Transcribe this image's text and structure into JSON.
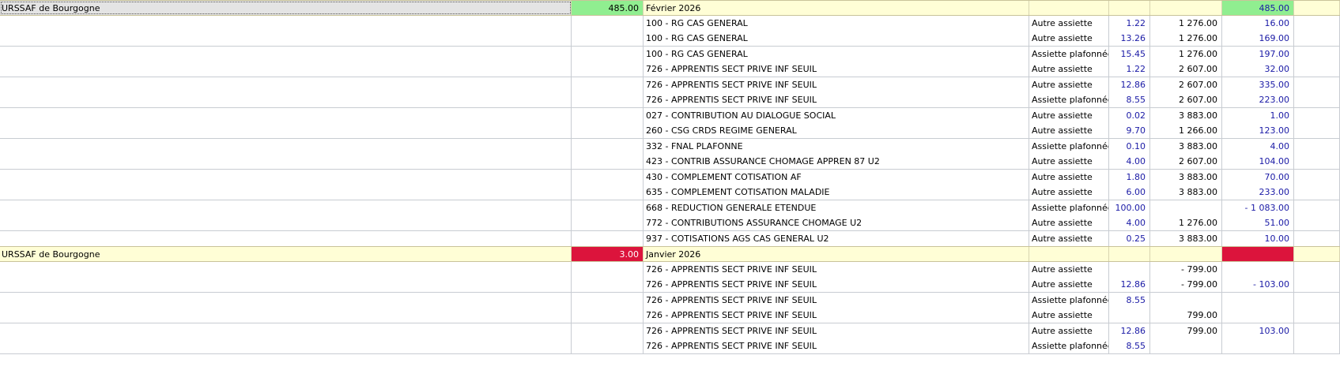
{
  "colors": {
    "group_bg": "#fffed6",
    "positive_total": "#90ee90",
    "negative_total": "#dc143c",
    "value_blue": "#1a1aa6"
  },
  "groups": [
    {
      "organisme": "URSSAF de Bourgogne",
      "montant": "485.00",
      "periode": "Février 2026",
      "total": "485.00",
      "status": "ok",
      "lines": [
        {
          "code": "100 - RG CAS GENERAL",
          "assiette": "Autre assiette",
          "taux": "1.22",
          "base": "1 276.00",
          "montant": "16.00"
        },
        {
          "code": "100 - RG CAS GENERAL",
          "assiette": "Autre assiette",
          "taux": "13.26",
          "base": "1 276.00",
          "montant": "169.00"
        },
        {
          "code": "100 - RG CAS GENERAL",
          "assiette": "Assiette plafonnée",
          "taux": "15.45",
          "base": "1 276.00",
          "montant": "197.00"
        },
        {
          "code": "726 - APPRENTIS SECT PRIVE INF SEUIL",
          "assiette": "Autre assiette",
          "taux": "1.22",
          "base": "2 607.00",
          "montant": "32.00"
        },
        {
          "code": "726 - APPRENTIS SECT PRIVE INF SEUIL",
          "assiette": "Autre assiette",
          "taux": "12.86",
          "base": "2 607.00",
          "montant": "335.00"
        },
        {
          "code": "726 - APPRENTIS SECT PRIVE INF SEUIL",
          "assiette": "Assiette plafonnée",
          "taux": "8.55",
          "base": "2 607.00",
          "montant": "223.00"
        },
        {
          "code": "027 - CONTRIBUTION AU DIALOGUE SOCIAL",
          "assiette": "Autre assiette",
          "taux": "0.02",
          "base": "3 883.00",
          "montant": "1.00"
        },
        {
          "code": "260 - CSG CRDS REGIME GENERAL",
          "assiette": "Autre assiette",
          "taux": "9.70",
          "base": "1 266.00",
          "montant": "123.00"
        },
        {
          "code": "332 - FNAL PLAFONNE",
          "assiette": "Assiette plafonnée",
          "taux": "0.10",
          "base": "3 883.00",
          "montant": "4.00"
        },
        {
          "code": "423 - CONTRIB ASSURANCE CHOMAGE APPREN 87 U2",
          "assiette": "Autre assiette",
          "taux": "4.00",
          "base": "2 607.00",
          "montant": "104.00"
        },
        {
          "code": "430 - COMPLEMENT COTISATION AF",
          "assiette": "Autre assiette",
          "taux": "1.80",
          "base": "3 883.00",
          "montant": "70.00"
        },
        {
          "code": "635 - COMPLEMENT COTISATION MALADIE",
          "assiette": "Autre assiette",
          "taux": "6.00",
          "base": "3 883.00",
          "montant": "233.00"
        },
        {
          "code": "668 - REDUCTION GENERALE ETENDUE",
          "assiette": "Assiette plafonnée",
          "taux": "100.00",
          "base": "",
          "montant": "- 1 083.00"
        },
        {
          "code": "772 - CONTRIBUTIONS ASSURANCE CHOMAGE U2",
          "assiette": "Autre assiette",
          "taux": "4.00",
          "base": "1 276.00",
          "montant": "51.00"
        },
        {
          "code": "937 - COTISATIONS AGS CAS GENERAL U2",
          "assiette": "Autre assiette",
          "taux": "0.25",
          "base": "3 883.00",
          "montant": "10.00"
        }
      ]
    },
    {
      "organisme": "URSSAF de Bourgogne",
      "montant": "3.00",
      "periode": "Janvier 2026",
      "total": "",
      "status": "error",
      "lines": [
        {
          "code": "726 - APPRENTIS SECT PRIVE INF SEUIL",
          "assiette": "Autre assiette",
          "taux": "",
          "base": "- 799.00",
          "montant": ""
        },
        {
          "code": "726 - APPRENTIS SECT PRIVE INF SEUIL",
          "assiette": "Autre assiette",
          "taux": "12.86",
          "base": "- 799.00",
          "montant": "- 103.00"
        },
        {
          "code": "726 - APPRENTIS SECT PRIVE INF SEUIL",
          "assiette": "Assiette plafonnée",
          "taux": "8.55",
          "base": "",
          "montant": ""
        },
        {
          "code": "726 - APPRENTIS SECT PRIVE INF SEUIL",
          "assiette": "Autre assiette",
          "taux": "",
          "base": "799.00",
          "montant": ""
        },
        {
          "code": "726 - APPRENTIS SECT PRIVE INF SEUIL",
          "assiette": "Autre assiette",
          "taux": "12.86",
          "base": "799.00",
          "montant": "103.00"
        },
        {
          "code": "726 - APPRENTIS SECT PRIVE INF SEUIL",
          "assiette": "Assiette plafonnée",
          "taux": "8.55",
          "base": "",
          "montant": ""
        }
      ]
    }
  ]
}
